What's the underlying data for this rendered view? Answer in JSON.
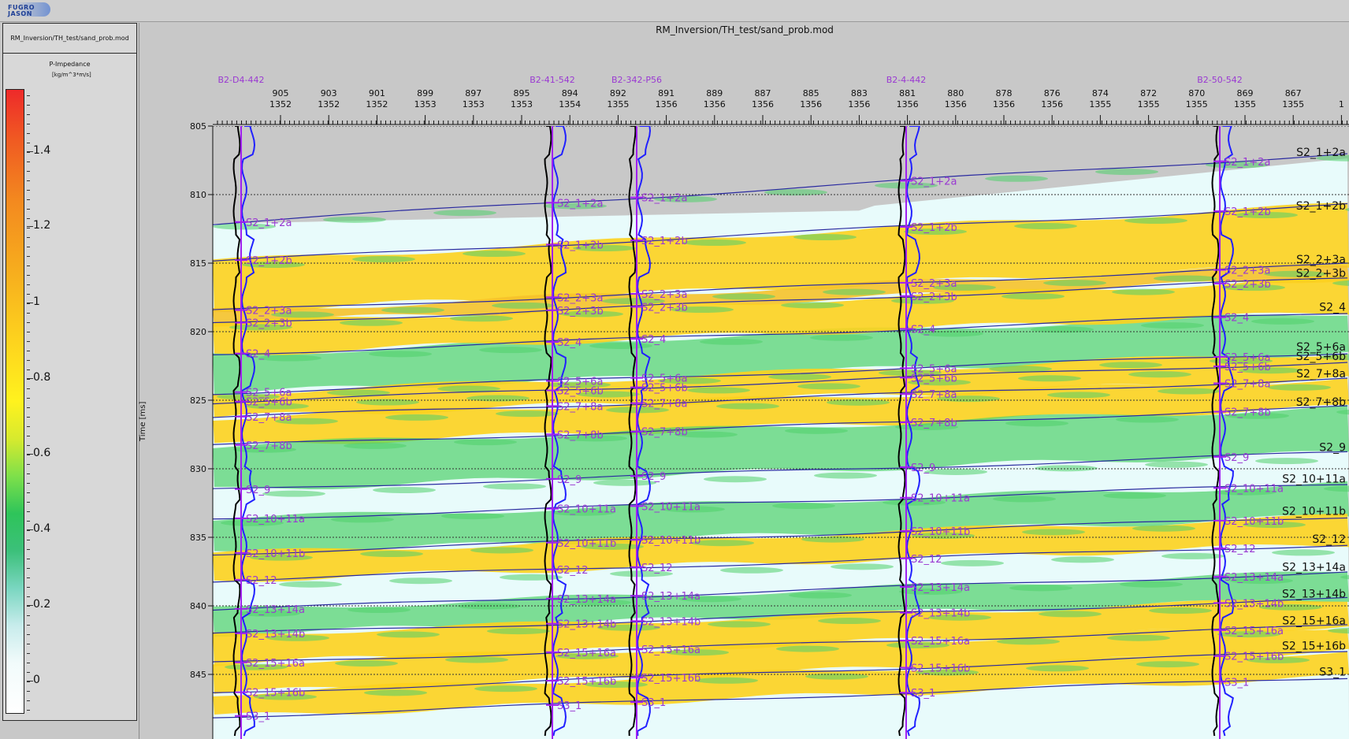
{
  "app": {
    "logo": {
      "line1": "FUGRO",
      "line2": "JASON"
    }
  },
  "legend": {
    "file": "RM_Inversion/TH_test/sand_prob.mod",
    "title": "P-Impedance",
    "unit": "[kg/m^3*m/s]",
    "ticks": [
      "1.4",
      "1.2",
      "1",
      "0.8",
      "0.6",
      "0.4",
      "0.2",
      "0"
    ],
    "colors": {
      "high": "#ee2a2a",
      "mid": "#fdd21e",
      "low": "#2ec45a",
      "zero": "#ffffff"
    }
  },
  "section": {
    "title": "RM_Inversion/TH_test/sand_prob.mod",
    "y_axis_label": "Time [ms]",
    "time_labels": [
      "805",
      "810",
      "815",
      "820",
      "825",
      "830",
      "835",
      "840",
      "845"
    ],
    "top_scale_row1": [
      "905",
      "903",
      "901",
      "899",
      "897",
      "895",
      "894",
      "892",
      "891",
      "889",
      "887",
      "885",
      "883",
      "881",
      "880",
      "878",
      "876",
      "874",
      "872",
      "870",
      "869",
      "867"
    ],
    "top_scale_row2": [
      "1352",
      "1352",
      "1352",
      "1353",
      "1353",
      "1353",
      "1354",
      "1355",
      "1356",
      "1356",
      "1356",
      "1356",
      "1356",
      "1356",
      "1356",
      "1356",
      "1356",
      "1355",
      "1355",
      "1355",
      "1355",
      "1355",
      "1"
    ],
    "wells": [
      {
        "name": "B2-D4-442",
        "tops": [
          "S2_1+2a",
          "S2_1+2b",
          "S2_2+3a",
          "S2_2+3b",
          "S2_4",
          "S2_5+6a",
          "S2_5+6b",
          "S2_7+8a",
          "S2_7+8b",
          "S2_9",
          "S2_10+11a",
          "S2_10+11b",
          "S2_12",
          "S2_13+14a",
          "S2_13+14b",
          "S2_15+16a",
          "S2_15+16b",
          "S3_1"
        ]
      },
      {
        "name": "B2-41-542",
        "tops": [
          "S2_1+2a",
          "S2_1+2b",
          "S2_2+3a",
          "S2_2+3b",
          "S2_4",
          "S2_5+6a",
          "S2_5+6b",
          "S2_7+8a",
          "S2_7+8b",
          "S2_9",
          "S2_10+11a",
          "S2_10+11b",
          "S2_12",
          "S2_13+14a",
          "S2_13+14b",
          "S2_15+16a",
          "S2_15+16b",
          "S3_1"
        ]
      },
      {
        "name": "B2-342-P56",
        "tops": [
          "S2_1+2a",
          "S2_1+2b",
          "S2_2+3a",
          "S2_2+3b",
          "S2_4",
          "S2_5+6a",
          "S2_5+6b",
          "S2_7+8a",
          "S2_7+8b",
          "S2_9",
          "S2_10+11a",
          "S2_10+11b",
          "S2_12",
          "S2_13+14a",
          "S2_13+14b",
          "S2_15+16a",
          "S2_15+16b",
          "S3_1"
        ]
      },
      {
        "name": "B2-4-442",
        "tops": [
          "S2_1+2a",
          "S2_1+2b",
          "S2_2+3a",
          "S2_2+3b",
          "S2_4",
          "S2_5+6a",
          "S2_5+6b",
          "S2_7+8a",
          "S2_7+8b",
          "S2_9",
          "S2_10+11a",
          "S2_10+11b",
          "S2_12",
          "S2_13+14a",
          "S2_13+14b",
          "S2_15+16a",
          "S2_15+16b",
          "S3_1"
        ]
      },
      {
        "name": "B2-50-542",
        "tops": [
          "S2_1+2a",
          "S2_1+2b",
          "S2_2+3a",
          "S2_2+3b",
          "S2_4",
          "S2_5+6a",
          "S2_5+6b",
          "S2_7+8a",
          "S2_7+8b",
          "S2_9",
          "S2_10+11a",
          "S2_10+11b",
          "S2_12",
          "S2_13+14a",
          "S2_13+14b",
          "S2_15+16a",
          "S2_15+16b",
          "S3_1"
        ]
      }
    ],
    "horizon_labels": [
      "S2_1+2a",
      "S2_1+2b",
      "S2_2+3a",
      "S2_2+3b",
      "S2_4",
      "S2_5+6a",
      "S2_5+6b",
      "S2_7+8a",
      "S2_7+8b",
      "S2_9",
      "S2_10+11a",
      "S2_10+11b",
      "S2_12",
      "S2_13+14a",
      "S2_13+14b",
      "S2_15+16a",
      "S2_15+16b",
      "S3_1"
    ],
    "colors": {
      "well_label": "#9a39d2",
      "horizon": "#2a2aa0",
      "log_blue": "#2020ff",
      "background": "#e8fbfb",
      "sand": "#fdd21e",
      "green": "#4fd06a"
    }
  }
}
